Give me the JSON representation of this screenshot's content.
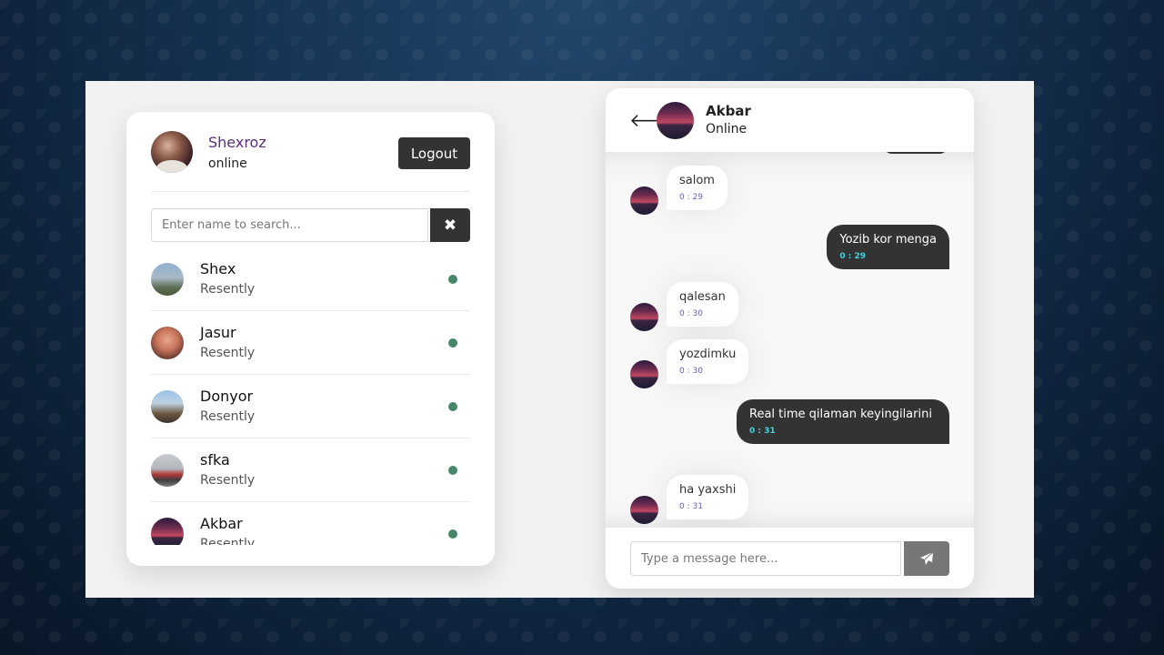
{
  "me": {
    "name": "Shexroz",
    "status": "online"
  },
  "logout_label": "Logout",
  "search": {
    "placeholder": "Enter name to search..."
  },
  "clear_icon": "close-icon",
  "users": [
    {
      "name": "Shex",
      "message": "Resently",
      "status": "online"
    },
    {
      "name": "Jasur",
      "message": "Resently",
      "status": "online"
    },
    {
      "name": "Donyor",
      "message": "Resently",
      "status": "online"
    },
    {
      "name": "sfka",
      "message": "Resently",
      "status": "online"
    },
    {
      "name": "Akbar",
      "message": "Resently",
      "status": "online"
    }
  ],
  "chat": {
    "contact_name": "Akbar",
    "contact_status": "Online",
    "messages": [
      {
        "direction": "incoming",
        "text": "salom",
        "time": "0 : 29"
      },
      {
        "direction": "outgoing",
        "text": "Yozib kor menga",
        "time": "0 : 29"
      },
      {
        "direction": "incoming",
        "text": "qalesan",
        "time": "0 : 30"
      },
      {
        "direction": "incoming",
        "text": "yozdimku",
        "time": "0 : 30"
      },
      {
        "direction": "outgoing",
        "text": "Real time qilaman keyingilarini",
        "time": "0 : 31"
      },
      {
        "direction": "incoming",
        "text": "ha yaxshi",
        "time": "0 : 31"
      }
    ],
    "input_placeholder": "Type a message here...",
    "send_icon": "paper-plane-icon"
  },
  "colors": {
    "dark": "#333333",
    "online_dot": "#468669",
    "name_purple": "#5b2f7a",
    "time_in": "#6a5acd",
    "time_out": "#3ed3e0"
  }
}
